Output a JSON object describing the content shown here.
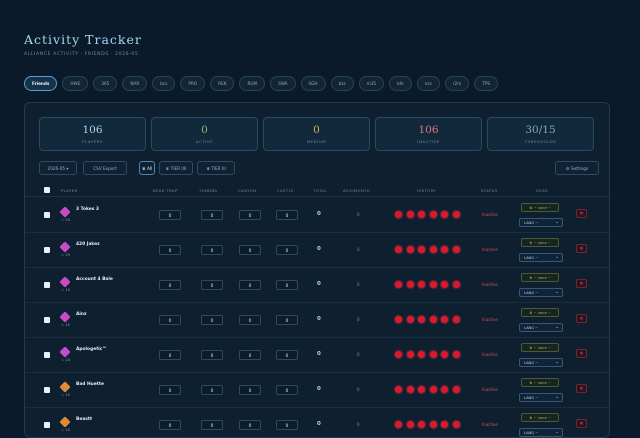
{
  "header": {
    "title": "Activity Tracker",
    "subtitle": "ALLIANCE ACTIVITY · FRIENDS · 2026-05"
  },
  "tabs": [
    {
      "label": "Friends",
      "active": true
    },
    {
      "label": "HWE"
    },
    {
      "label": "365"
    },
    {
      "label": "NAR"
    },
    {
      "label": "bcs"
    },
    {
      "label": "PRO"
    },
    {
      "label": "REK"
    },
    {
      "label": "RUM"
    },
    {
      "label": "SWA"
    },
    {
      "label": "SGH"
    },
    {
      "label": "bzz"
    },
    {
      "label": "m35"
    },
    {
      "label": "bfe"
    },
    {
      "label": "nzs"
    },
    {
      "label": "r2m"
    },
    {
      "label": "TPS"
    }
  ],
  "stats": [
    {
      "value": "106",
      "label": "PLAYERS",
      "color": "#a8d6f0"
    },
    {
      "value": "0",
      "label": "ACTIVE",
      "color": "#7ac27a"
    },
    {
      "value": "0",
      "label": "MEDIUM",
      "color": "#d6b25a"
    },
    {
      "value": "106",
      "label": "INACTIVE",
      "color": "#e07a7a"
    },
    {
      "value": "30/15",
      "label": "THRESHOLDS",
      "color": "#8ba5b9"
    }
  ],
  "toolbar": {
    "month": "2026-05",
    "csv_export": "CSV Export",
    "filter_all": "All",
    "filter_gear1": "TIER I/II",
    "filter_gear2": "TIER III",
    "settings": "Settings"
  },
  "columns": {
    "players": "PLAYER",
    "bear_trap": "BEAR TRAP",
    "tundra": "TUNDRA",
    "canyon": "CANYON",
    "castle": "CASTLE",
    "total": "TOTAL",
    "avg": "AVG/MONTH",
    "history": "HISTORY",
    "status": "STATUS",
    "gear": "GEAR"
  },
  "rows": [
    {
      "name": "3 Tokes 3",
      "meta": "♨ 24",
      "color": "#c94ac9",
      "values": [
        "0",
        "0",
        "0",
        "0"
      ],
      "total": "0",
      "avg": "0",
      "status": "Inactive",
      "gear": "♛ ~ none ~",
      "lang": "LANG ~"
    },
    {
      "name": "420 Jakez",
      "meta": "♨ 25",
      "color": "#c94ac9",
      "values": [
        "0",
        "0",
        "0",
        "0"
      ],
      "total": "0",
      "avg": "0",
      "status": "Inactive",
      "gear": "♛ ~ none ~",
      "lang": "LANG ~"
    },
    {
      "name": "Account 4 Bale",
      "meta": "♨ 15",
      "color": "#c94ac9",
      "values": [
        "0",
        "0",
        "0",
        "0"
      ],
      "total": "0",
      "avg": "0",
      "status": "Inactive",
      "gear": "♛ ~ none ~",
      "lang": "LANG ~"
    },
    {
      "name": "Ainz",
      "meta": "♨ 15",
      "color": "#c94ac9",
      "values": [
        "0",
        "0",
        "0",
        "0"
      ],
      "total": "0",
      "avg": "0",
      "status": "Inactive",
      "gear": "♛ ~ none ~",
      "lang": "LANG ~"
    },
    {
      "name": "Apologetic™",
      "meta": "♨ 24",
      "color": "#c94ac9",
      "values": [
        "0",
        "0",
        "0",
        "0"
      ],
      "total": "0",
      "avg": "0",
      "status": "Inactive",
      "gear": "♛ ~ none ~",
      "lang": "LANG ~"
    },
    {
      "name": "Bad Huette",
      "meta": "♨ 15",
      "color": "#e08a3a",
      "values": [
        "0",
        "0",
        "0",
        "0"
      ],
      "total": "0",
      "avg": "0",
      "status": "Inactive",
      "gear": "♛ ~ none ~",
      "lang": "LANG ~"
    },
    {
      "name": "Beastt",
      "meta": "♨ 15",
      "color": "#e08a3a",
      "values": [
        "0",
        "0",
        "0",
        "0"
      ],
      "total": "0",
      "avg": "0",
      "status": "Inactive",
      "gear": "♛ ~ none ~",
      "lang": "LANG ~"
    }
  ]
}
